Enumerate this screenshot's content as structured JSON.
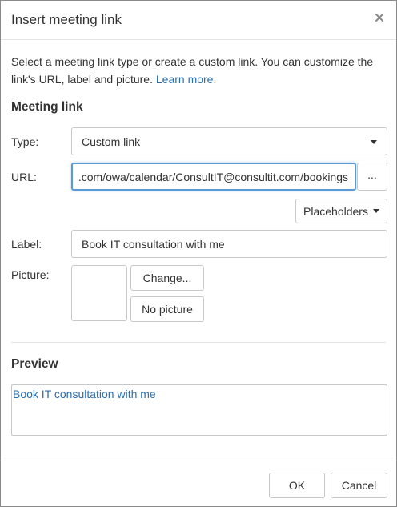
{
  "dialog": {
    "title": "Insert meeting link",
    "close_icon": "close-icon"
  },
  "intro": {
    "text": "Select a meeting link type or create a custom link. You can customize the link's URL, label and picture. ",
    "learn_more": "Learn more",
    "end": "."
  },
  "meeting_link": {
    "heading": "Meeting link",
    "type_label": "Type:",
    "type_value": "Custom link",
    "url_label": "URL:",
    "url_value": "https://outlook.office.com/owa/calendar/ConsultIT@consultit.com/bookings/",
    "url_more_label": "...",
    "placeholders_label": "Placeholders",
    "label_label": "Label:",
    "label_value": "Book IT consultation with me",
    "picture_label": "Picture:",
    "change_label": "Change...",
    "no_picture_label": "No picture"
  },
  "preview": {
    "heading": "Preview",
    "link_text": "Book IT consultation with me"
  },
  "footer": {
    "ok_label": "OK",
    "cancel_label": "Cancel"
  },
  "colors": {
    "accent": "#2a6fb2",
    "focus_border": "#5b9bd5"
  }
}
